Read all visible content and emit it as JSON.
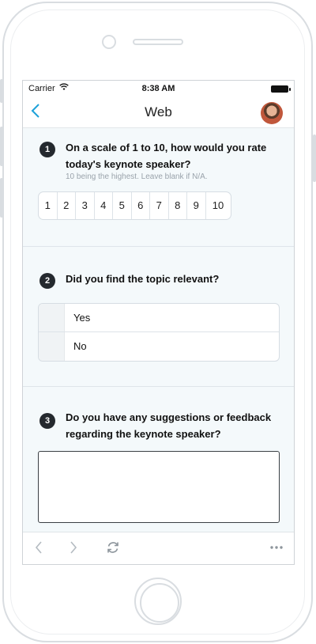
{
  "status": {
    "carrier": "Carrier",
    "time": "8:38 AM"
  },
  "nav": {
    "title": "Web",
    "back_icon": "chevron-left-icon"
  },
  "questions": [
    {
      "number": "1",
      "text": "On a scale of 1 to 10, how would you rate today's keynote speaker?",
      "hint": "10 being the highest. Leave blank if N/A.",
      "scale": [
        "1",
        "2",
        "3",
        "4",
        "5",
        "6",
        "7",
        "8",
        "9",
        "10"
      ]
    },
    {
      "number": "2",
      "text": "Did you find the topic relevant?",
      "options": [
        "Yes",
        "No"
      ]
    },
    {
      "number": "3",
      "text": "Do you have any suggestions or feedback regarding the keynote speaker?",
      "answer": ""
    }
  ],
  "toolbar": {
    "back": "chevron-left-icon",
    "forward": "chevron-right-icon",
    "refresh": "refresh-icon",
    "more": "more-icon"
  },
  "colors": {
    "accent": "#1da1d9",
    "background": "#f4f9fb",
    "number_badge": "#24292e"
  }
}
